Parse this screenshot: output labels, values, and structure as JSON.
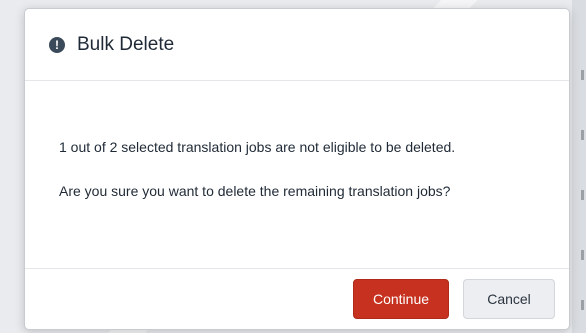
{
  "dialog": {
    "title": "Bulk Delete",
    "icon": "exclamation-circle-icon",
    "icon_glyph": "!",
    "message_1": "1 out of 2 selected translation jobs are not eligible to be deleted.",
    "message_2": "Are you sure you want to delete the remaining translation jobs?",
    "continue_label": "Continue",
    "cancel_label": "Cancel"
  },
  "colors": {
    "primary_button": "#c6321f",
    "secondary_button": "#eceef1",
    "icon": "#3b4a5a"
  }
}
